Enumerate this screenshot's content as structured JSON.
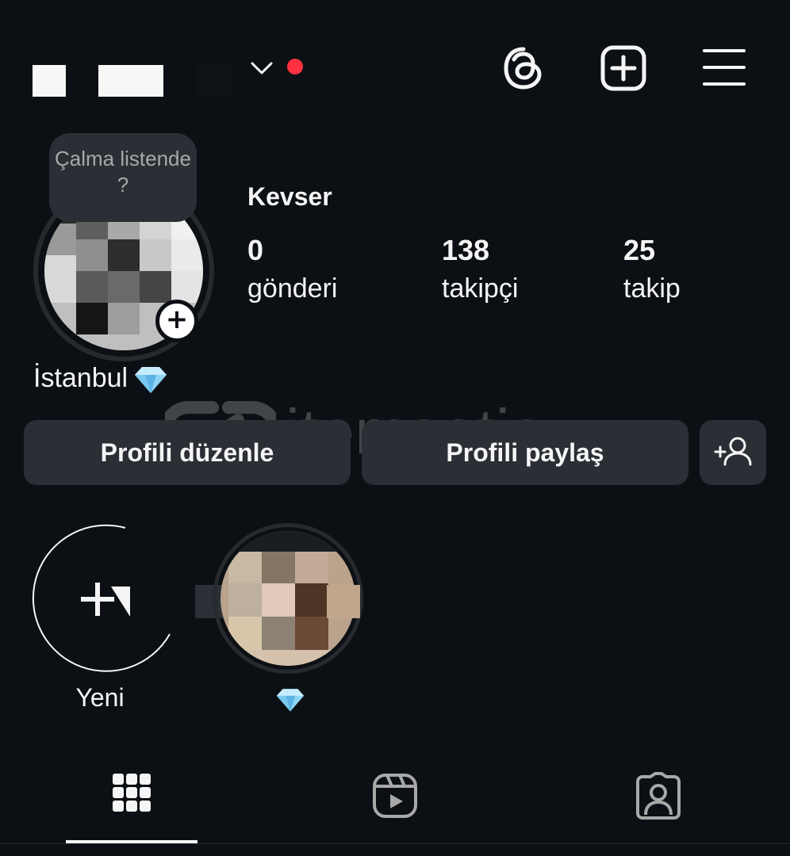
{
  "header": {
    "accent_dot_color": "#ff3040",
    "icons": [
      "chevron-down-icon",
      "threads-icon",
      "new-post-icon",
      "menu-icon"
    ]
  },
  "profile": {
    "note": "Çalma listende ?",
    "full_name": "Kevser",
    "stats": [
      {
        "value": "0",
        "label": "gönderi"
      },
      {
        "value": "138",
        "label": "takipçi"
      },
      {
        "value": "25",
        "label": "takip"
      }
    ],
    "bio": "İstanbul",
    "bio_emoji": "gem-icon"
  },
  "actions": {
    "edit_label": "Profili düzenle",
    "share_label": "Profili paylaş",
    "add_icon": "add-person-icon"
  },
  "watermark": {
    "text": "itemsatis"
  },
  "highlights": [
    {
      "label": "Yeni",
      "icon": "new-highlight-icon"
    },
    {
      "label": "",
      "icon": "gem-icon"
    }
  ],
  "tabs": [
    {
      "icon": "grid-icon",
      "active": true
    },
    {
      "icon": "reels-icon",
      "active": false
    },
    {
      "icon": "tagged-icon",
      "active": false
    }
  ],
  "colors": {
    "background": "#0c1014",
    "button": "#2b2f35",
    "text": "#f5f5f5"
  }
}
